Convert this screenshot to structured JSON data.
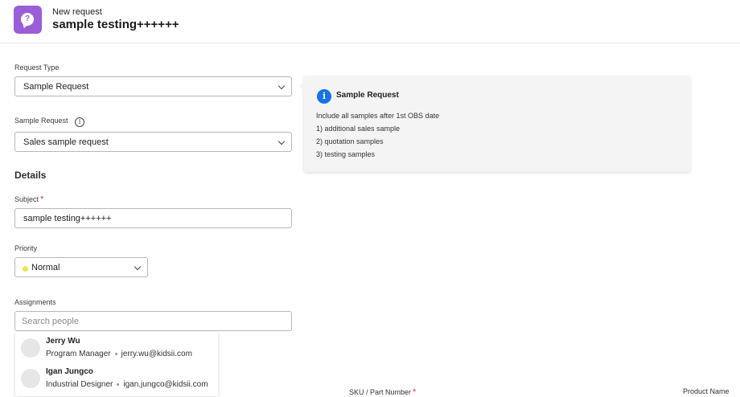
{
  "header": {
    "kicker": "New request",
    "title": "sample testing++++++",
    "app_icon": "help-chat-icon",
    "icon_color": "#9a5fd6"
  },
  "form": {
    "request_type": {
      "label": "Request Type",
      "value": "Sample Request"
    },
    "sample_request": {
      "label": "Sample Request",
      "value": "Sales sample request",
      "info_icon": "info-icon"
    },
    "details_title": "Details",
    "subject": {
      "label": "Subject",
      "required_mark": "*",
      "value": "sample testing++++++"
    },
    "priority": {
      "label": "Priority",
      "value": "Normal",
      "dot_color": "#e6e84c"
    },
    "assignments": {
      "label": "Assignments",
      "placeholder": "Search people",
      "people": [
        {
          "name": "Jerry Wu",
          "title": "Program Manager",
          "email": "jerry.wu@kidsii.com"
        },
        {
          "name": "Igan Jungco",
          "title": "Industrial Designer",
          "email": "igan.jungco@kidsii.com"
        }
      ]
    }
  },
  "info_card": {
    "icon": "info-icon",
    "icon_color": "#1473e6",
    "title": "Sample Request",
    "lines": [
      "Include all samples after 1st OBS date",
      "1) additional sales sample",
      "2) quotation samples",
      "3) testing samples"
    ]
  },
  "table_headers": {
    "sku": "SKU / Part Number",
    "sku_required": "*",
    "product_name": "Product Name"
  }
}
